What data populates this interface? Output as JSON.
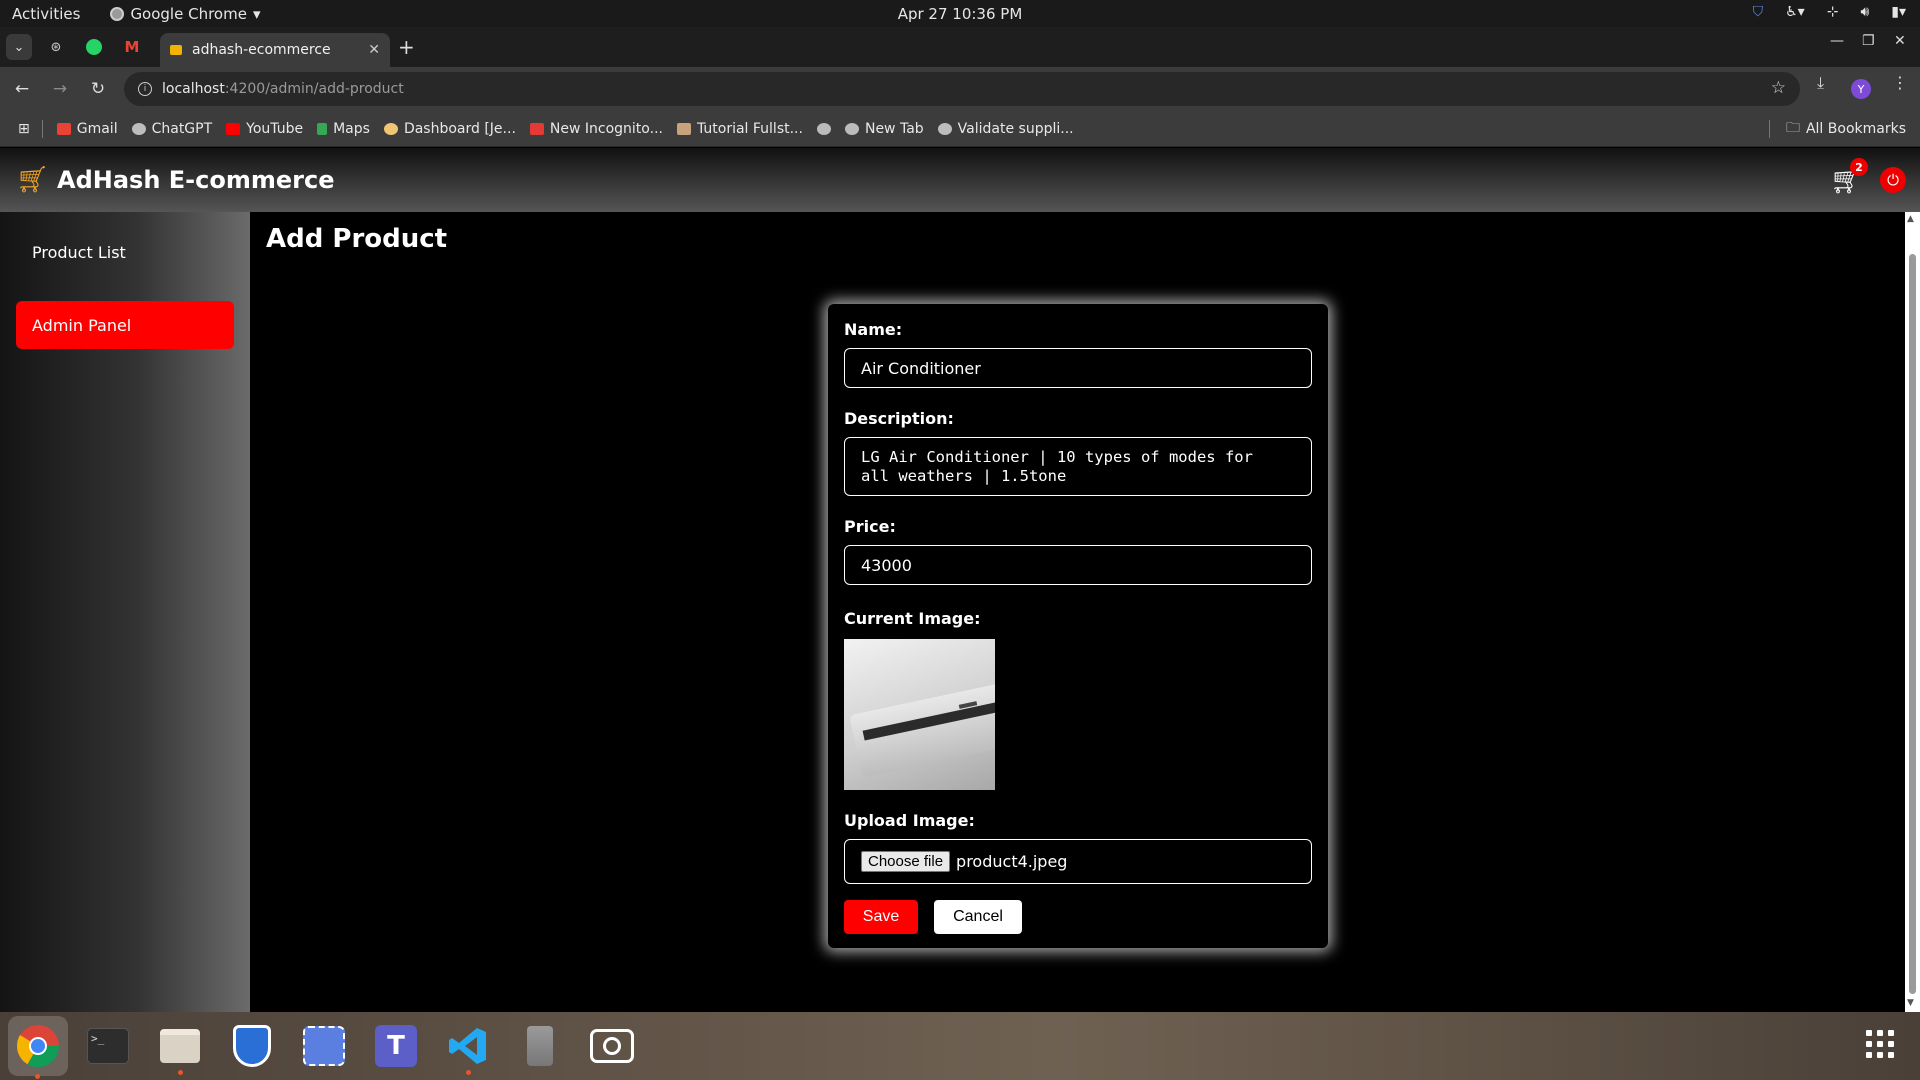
{
  "system_bar": {
    "activities": "Activities",
    "app_name": "Google Chrome",
    "clock": "Apr 27  10:36 PM"
  },
  "browser": {
    "tab_title": "adhash-ecommerce",
    "url_host": "localhost",
    "url_path": ":4200/admin/add-product",
    "profile_initial": "Y",
    "bookmarks": [
      {
        "label": "Gmail",
        "color": "#ea4335"
      },
      {
        "label": "ChatGPT",
        "color": "#bdbdbd"
      },
      {
        "label": "YouTube",
        "color": "#ff0000"
      },
      {
        "label": "Maps",
        "color": "#34a853"
      },
      {
        "label": "Dashboard [Je...",
        "color": "#f0c674"
      },
      {
        "label": "New Incognito...",
        "color": "#e53935"
      },
      {
        "label": "Tutorial Fullst...",
        "color": "#c8a27a"
      },
      {
        "label": "",
        "color": "#bbbbbb"
      },
      {
        "label": "New Tab",
        "color": "#bbbbbb"
      },
      {
        "label": "Validate suppli...",
        "color": "#bdbdbd"
      }
    ],
    "all_bookmarks": "All Bookmarks"
  },
  "header": {
    "brand": "AdHash E-commerce",
    "cart_count": "2",
    "brand_color": "#ffffff",
    "accent": "#ff0000"
  },
  "sidebar": {
    "items": [
      {
        "label": "Product List",
        "active": false
      },
      {
        "label": "Admin Panel",
        "active": true
      }
    ]
  },
  "main": {
    "title": "Add Product",
    "form": {
      "name_label": "Name:",
      "name_value": "Air Conditioner",
      "description_label": "Description:",
      "description_value": "LG Air Conditioner | 10 types of modes for\nall weathers | 1.5tone",
      "price_label": "Price:",
      "price_value": "43000",
      "current_image_label": "Current Image:",
      "upload_label": "Upload Image:",
      "choose_file": "Choose file",
      "file_name": "product4.jpeg",
      "save": "Save",
      "cancel": "Cancel"
    }
  },
  "dock": {
    "apps": [
      "chrome-icon",
      "terminal-icon",
      "files-icon",
      "shield-icon",
      "screenshot-icon",
      "teams-icon",
      "vscode-icon",
      "device-icon",
      "camera-icon"
    ]
  }
}
